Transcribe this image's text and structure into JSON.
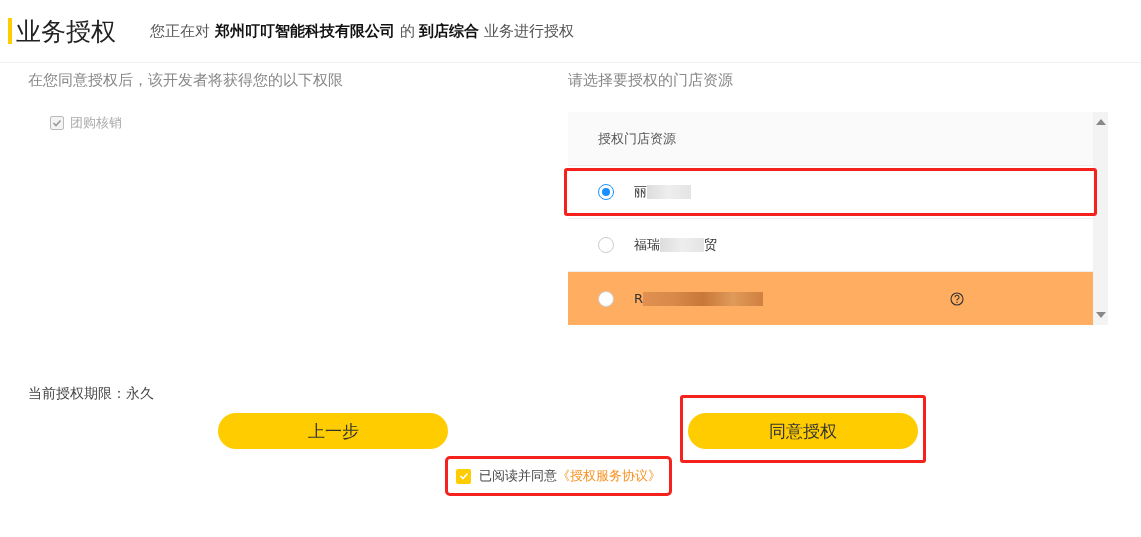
{
  "header": {
    "title": "业务授权",
    "subtitle": "您正在对 **郑州叮叮智能科技有限公司** 的 **到店综合** 业务进行授权"
  },
  "permissions": {
    "heading": "在您同意授权后，该开发者将获得您的以下权限",
    "items": [
      {
        "label": "团购核销",
        "checked": true,
        "disabled": true
      }
    ]
  },
  "stores": {
    "heading": "请选择要授权的门店资源",
    "column": "授权门店资源",
    "rows": [
      {
        "name": "丽",
        "selected": true,
        "hovered": false,
        "highlighted": true,
        "help": false
      },
      {
        "name": "福瑞",
        "name_end": "贸",
        "selected": false,
        "hovered": false,
        "highlighted": false,
        "help": false
      },
      {
        "name": "R",
        "selected": false,
        "hovered": true,
        "highlighted": false,
        "help": true
      }
    ]
  },
  "term": "当前授权期限：永久",
  "buttons": [
    {
      "label": "上一步",
      "highlighted": false
    },
    {
      "label": "同意授权",
      "highlighted": true
    }
  ],
  "agreement": {
    "text": "已阅读并同意",
    "link": "《授权服务协议》",
    "checked": true,
    "highlighted": true
  }
}
